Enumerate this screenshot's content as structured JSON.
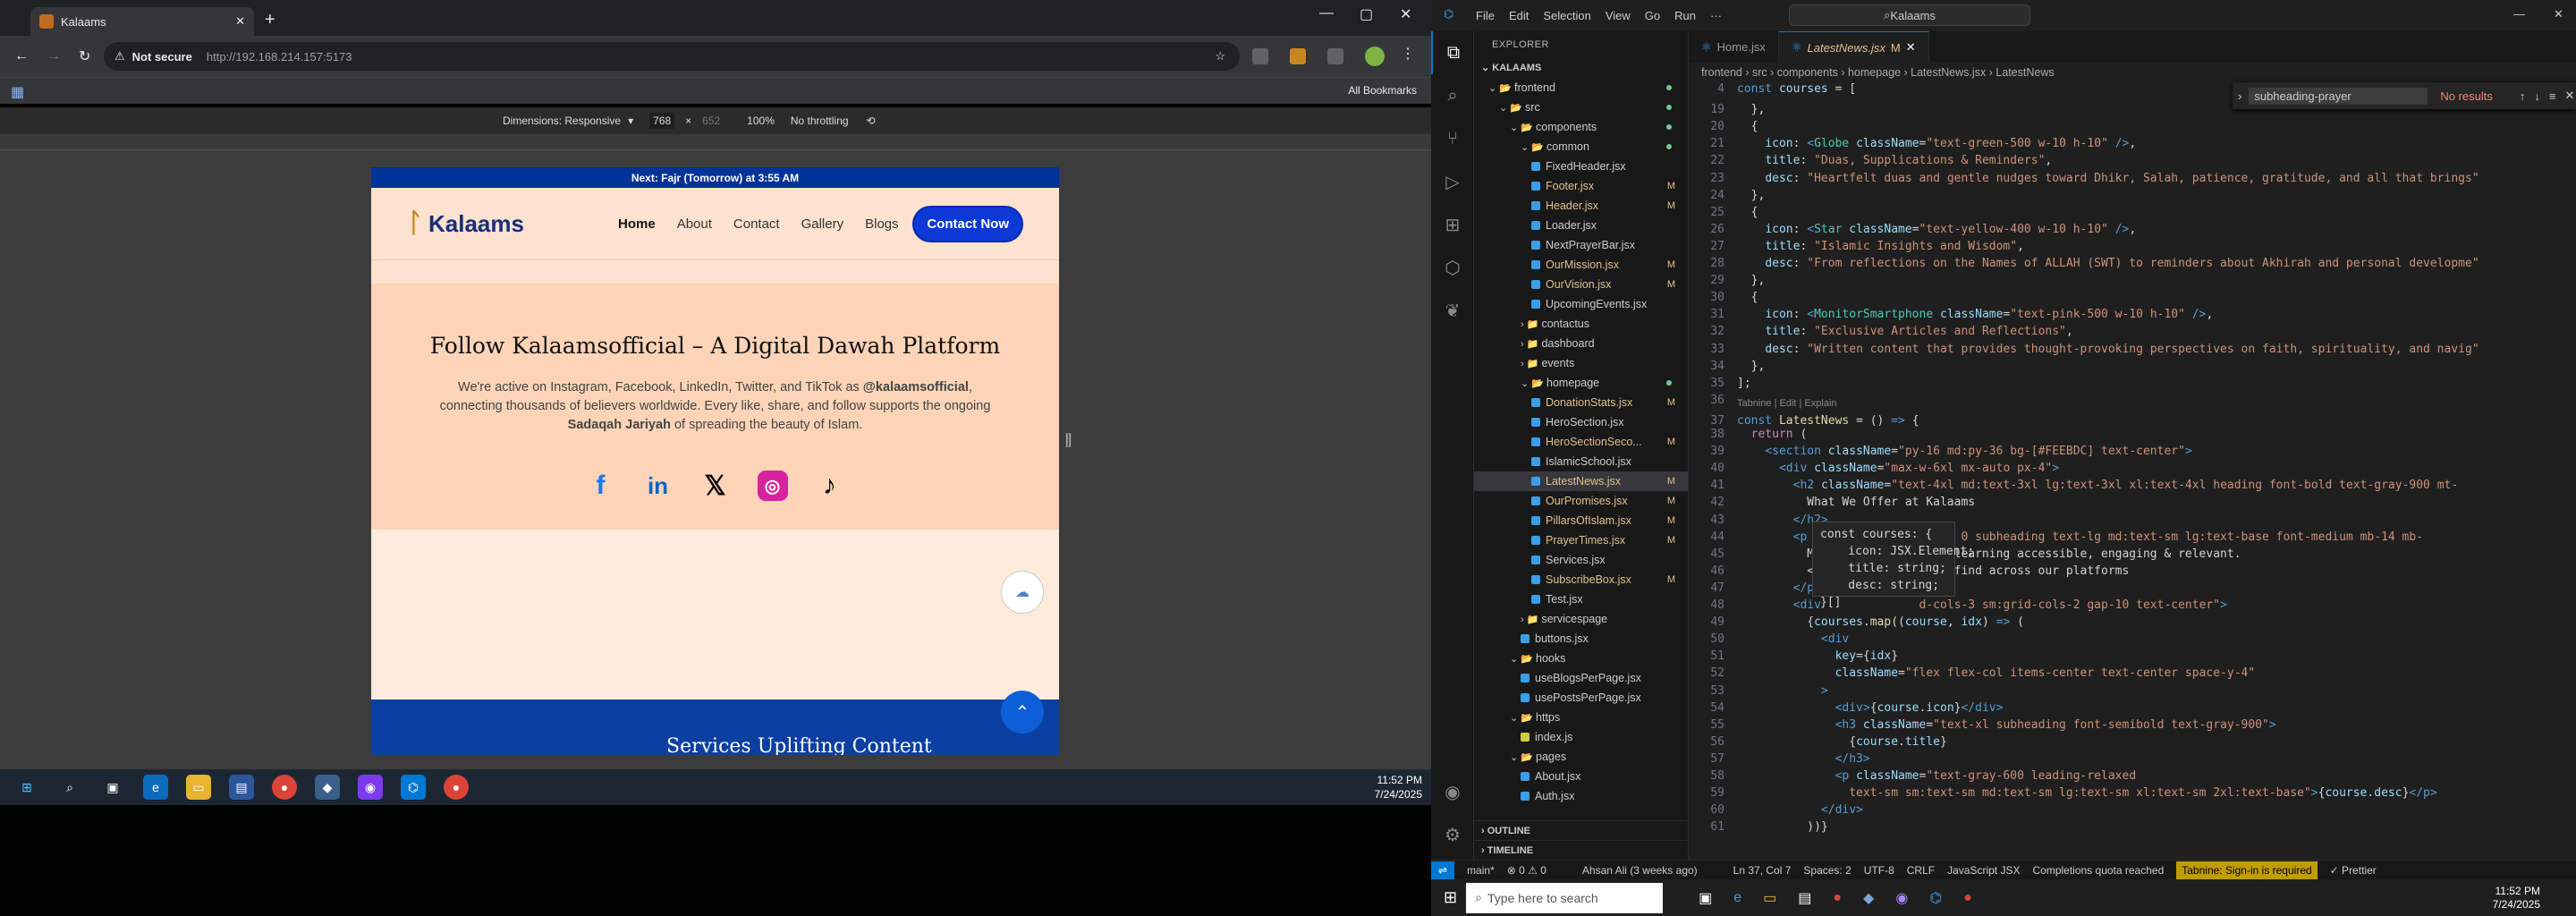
{
  "browser": {
    "tab_title": "Kalaams",
    "new_tab": "+",
    "not_secure": "Not secure",
    "url": "http://192.168.214.157:5173",
    "all_bookmarks": "All Bookmarks",
    "dims_label": "Dimensions: Responsive",
    "width": "768",
    "x": "×",
    "height": "652",
    "zoom": "100%",
    "throttle": "No throttling"
  },
  "site": {
    "prayer_bar": "Next: Fajr (Tomorrow) at 3:55 AM",
    "logo": "Kalaams",
    "nav": [
      "Home",
      "About",
      "Contact",
      "Gallery",
      "Blogs"
    ],
    "cta": "Contact Now",
    "follow_title": "Follow Kalaamsofficial – A Digital Dawah Platform",
    "follow_p1": "We're active on Instagram, Facebook, LinkedIn, Twitter, and TikTok as ",
    "handle": "@kalaamsofficial",
    "follow_p2": ", connecting thousands of believers worldwide. Every like, share, and follow supports the ongoing ",
    "sadaqah": "Sadaqah Jariyah",
    "follow_p3": " of spreading the beauty of Islam.",
    "bottom_heading": "Services Uplifting Content"
  },
  "taskbar_left": {
    "time": "11:52 PM",
    "date": "7/24/2025"
  },
  "vscode": {
    "menu": [
      "File",
      "Edit",
      "Selection",
      "View",
      "Go",
      "Run",
      "···"
    ],
    "search": "Kalaams",
    "explorer_title": "EXPLORER",
    "workspace": "KALAAMS",
    "tabs": [
      "Home.jsx",
      "LatestNews.jsx"
    ],
    "tab_modified": "M",
    "breadcrumb": "frontend › src › components › homepage › LatestNews.jsx › LatestNews",
    "find_value": "subheading-prayer",
    "find_result": "No results",
    "tree": [
      {
        "label": "frontend",
        "depth": 1,
        "type": "folder-open",
        "dot": true
      },
      {
        "label": "src",
        "depth": 2,
        "type": "folder-open",
        "dot": true
      },
      {
        "label": "components",
        "depth": 3,
        "type": "folder-open",
        "dot": true
      },
      {
        "label": "common",
        "depth": 4,
        "type": "folder-open",
        "dot": true
      },
      {
        "label": "FixedHeader.jsx",
        "depth": 5,
        "type": "file"
      },
      {
        "label": "Footer.jsx",
        "depth": 5,
        "type": "file",
        "m": "M"
      },
      {
        "label": "Header.jsx",
        "depth": 5,
        "type": "file",
        "m": "M"
      },
      {
        "label": "Loader.jsx",
        "depth": 5,
        "type": "file"
      },
      {
        "label": "NextPrayerBar.jsx",
        "depth": 5,
        "type": "file"
      },
      {
        "label": "OurMission.jsx",
        "depth": 5,
        "type": "file",
        "m": "M"
      },
      {
        "label": "OurVision.jsx",
        "depth": 5,
        "type": "file",
        "m": "M"
      },
      {
        "label": "UpcomingEvents.jsx",
        "depth": 5,
        "type": "file"
      },
      {
        "label": "contactus",
        "depth": 4,
        "type": "folder"
      },
      {
        "label": "dashboard",
        "depth": 4,
        "type": "folder"
      },
      {
        "label": "events",
        "depth": 4,
        "type": "folder"
      },
      {
        "label": "homepage",
        "depth": 4,
        "type": "folder-open",
        "dot": true
      },
      {
        "label": "DonationStats.jsx",
        "depth": 5,
        "type": "file",
        "m": "M"
      },
      {
        "label": "HeroSection.jsx",
        "depth": 5,
        "type": "file"
      },
      {
        "label": "HeroSectionSeco...",
        "depth": 5,
        "type": "file",
        "m": "M"
      },
      {
        "label": "IslamicSchool.jsx",
        "depth": 5,
        "type": "file"
      },
      {
        "label": "LatestNews.jsx",
        "depth": 5,
        "type": "file",
        "m": "M",
        "sel": true
      },
      {
        "label": "OurPromises.jsx",
        "depth": 5,
        "type": "file",
        "m": "M"
      },
      {
        "label": "PillarsOfIslam.jsx",
        "depth": 5,
        "type": "file",
        "m": "M"
      },
      {
        "label": "PrayerTimes.jsx",
        "depth": 5,
        "type": "file",
        "m": "M"
      },
      {
        "label": "Services.jsx",
        "depth": 5,
        "type": "file"
      },
      {
        "label": "SubscribeBox.jsx",
        "depth": 5,
        "type": "file",
        "m": "M"
      },
      {
        "label": "Test.jsx",
        "depth": 5,
        "type": "file"
      },
      {
        "label": "servicespage",
        "depth": 4,
        "type": "folder"
      },
      {
        "label": "buttons.jsx",
        "depth": 4,
        "type": "file"
      },
      {
        "label": "hooks",
        "depth": 3,
        "type": "folder-open"
      },
      {
        "label": "useBlogsPerPage.jsx",
        "depth": 4,
        "type": "file"
      },
      {
        "label": "usePostsPerPage.jsx",
        "depth": 4,
        "type": "file"
      },
      {
        "label": "https",
        "depth": 3,
        "type": "folder-open"
      },
      {
        "label": "index.js",
        "depth": 4,
        "type": "file"
      },
      {
        "label": "pages",
        "depth": 3,
        "type": "folder-open"
      },
      {
        "label": "About.jsx",
        "depth": 4,
        "type": "file"
      },
      {
        "label": "Auth.jsx",
        "depth": 4,
        "type": "file"
      }
    ],
    "outline": "OUTLINE",
    "timeline": "TIMELINE",
    "tabnine_hint": "Tabnine | Edit | Explain",
    "hover_lines": "const courses: {\n    icon: JSX.Element;\n    title: string;\n    desc: string;\n}[]",
    "status": {
      "branch": "main*",
      "errors": "⊗ 0 ⚠ 0",
      "author": "Ahsan Ali (3 weeks ago)",
      "pos": "Ln 37, Col 7",
      "spaces": "Spaces: 2",
      "enc": "UTF-8",
      "eol": "CRLF",
      "lang": "JavaScript JSX",
      "quota": "Completions quota reached",
      "tabnine": "Tabnine: Sign-in is required",
      "prettier": "✓ Prettier"
    }
  },
  "taskbar_right": {
    "search": "Type here to search",
    "time": "11:52 PM",
    "date": "7/24/2025"
  }
}
